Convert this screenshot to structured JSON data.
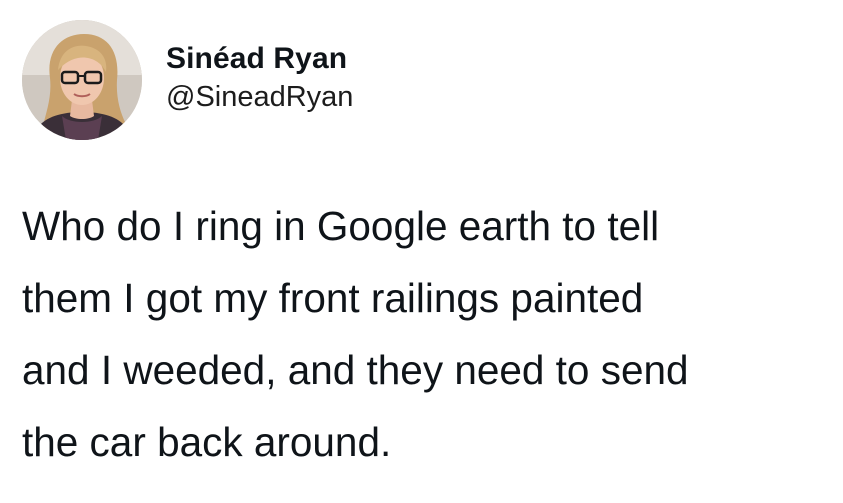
{
  "tweet": {
    "author": {
      "display_name": "Sinéad Ryan",
      "handle": "@SineadRyan",
      "avatar_icon": "profile-photo"
    },
    "text_lines": [
      "Who do I ring in Google earth to tell",
      "them I got my front railings painted",
      "and I weeded, and they need to send",
      "the car back around."
    ]
  }
}
